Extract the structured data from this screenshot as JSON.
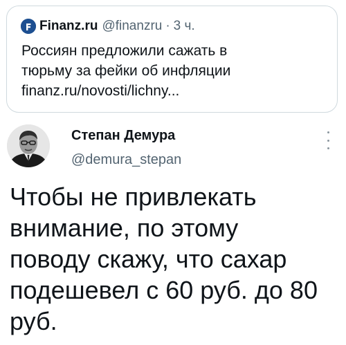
{
  "quoted_tweet": {
    "logo_icon": "finanz-logo-icon",
    "author_name": "Finanz.ru",
    "author_handle": "@finanzru",
    "separator": "·",
    "timestamp": "3 ч.",
    "text_lines": [
      "Россиян предложили сажать в",
      "тюрьму за фейки об инфляции",
      "finanz.ru/novosti/lichny..."
    ]
  },
  "tweet": {
    "avatar_icon": "user-avatar",
    "author_name": "Степан Демура",
    "author_handle": "@demura_stepan",
    "more_icon": "vertical-dots-icon",
    "text_lines": [
      "Чтобы не привлекать",
      "внимание, по этому",
      "поводу скажу, что сахар",
      "подешевел с 60 руб. до 80",
      "руб."
    ]
  },
  "colors": {
    "primary_text": "#0f1419",
    "secondary_text": "#536471",
    "border": "#cfd9de",
    "logo_bg": "#1d4f91"
  }
}
